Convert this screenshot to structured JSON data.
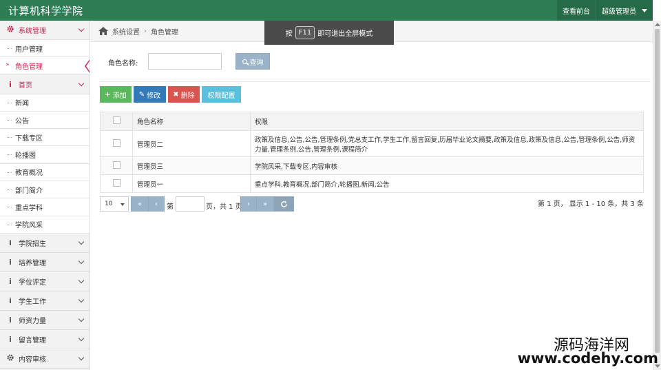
{
  "header": {
    "brand": "计算机科学学院",
    "front_link": "查看前台",
    "user_menu": "超级管理员"
  },
  "toast": {
    "before": "按",
    "key": "F11",
    "after": "即可退出全屏模式"
  },
  "breadcrumb": {
    "items": [
      "系统设置",
      "角色管理"
    ]
  },
  "sidebar": {
    "system": {
      "label": "系统管理",
      "icon": "gear-icon",
      "items": [
        "用户管理",
        "角色管理"
      ]
    },
    "home": {
      "label": "首页",
      "icon": "info-icon",
      "items": [
        "新闻",
        "公告",
        "下载专区",
        "轮播图",
        "教育概况",
        "部门简介",
        "重点学科",
        "学院风采"
      ]
    },
    "groups": [
      {
        "label": "学院招生",
        "icon": "info-icon"
      },
      {
        "label": "培养管理",
        "icon": "info-icon"
      },
      {
        "label": "学位评定",
        "icon": "info-icon"
      },
      {
        "label": "学生工作",
        "icon": "info-icon"
      },
      {
        "label": "师资力量",
        "icon": "info-icon"
      },
      {
        "label": "留言管理",
        "icon": "info-icon"
      },
      {
        "label": "内容审核",
        "icon": "gear-icon"
      }
    ],
    "active_item": "角色管理"
  },
  "search": {
    "label": "角色名称:",
    "value": "",
    "button": "查询"
  },
  "toolbar": {
    "add": "添加",
    "edit": "修改",
    "delete": "删除",
    "permissions": "权限配置"
  },
  "table": {
    "headers": [
      "角色名称",
      "权限"
    ],
    "rows": [
      {
        "name": "管理员二",
        "permissions": "政策及信息,公告,公告,管理条例,党总支工作,学生工作,留言回复,历届毕业论文摘要,政策及信息,政策及信息,公告,管理条例,公告,师资力量,管理条例,公告,管理条例,课程简介"
      },
      {
        "name": "管理员三",
        "permissions": "学院风采,下载专区,内容审核"
      },
      {
        "name": "管理员一",
        "permissions": "重点学科,教育概况,部门简介,轮播图,新闻,公告"
      }
    ]
  },
  "pager": {
    "page_size": "10",
    "first": "«",
    "prev": "‹",
    "label_page": "第",
    "page_input": "",
    "label_total": "页，共 1 页",
    "next": "›",
    "last": "»",
    "info": "第 1 页， 显示 1 - 10 条，共 3 条"
  },
  "watermark": {
    "line1": "源码海洋网",
    "line2": "www.codehy.com"
  },
  "colors": {
    "header": "#2e7d55",
    "accent_red": "#c7254e",
    "btn_add": "#5cb85c",
    "btn_edit": "#337ab7",
    "btn_delete": "#d9534f",
    "btn_perm": "#5bc0de"
  }
}
